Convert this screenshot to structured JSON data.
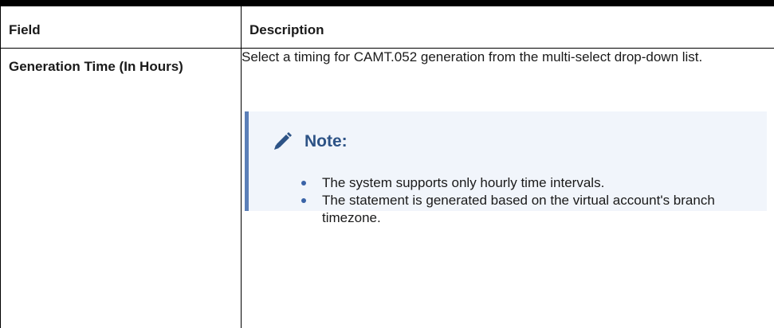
{
  "table": {
    "headers": {
      "field": "Field",
      "description": "Description"
    },
    "rows": [
      {
        "field": "Generation Time (In Hours)",
        "description": "Select a timing for CAMT.052 generation from the multi-select drop-down list.",
        "note": {
          "icon": "pencil-icon",
          "title": "Note:",
          "items": [
            "The system supports only hourly time intervals.",
            "The statement is generated based on the virtual account's branch timezone."
          ]
        }
      }
    ]
  },
  "colors": {
    "note_background": "#f1f5fb",
    "note_border": "#5b7fb8",
    "note_title": "#2d5386",
    "bullet": "#3a63a7"
  }
}
